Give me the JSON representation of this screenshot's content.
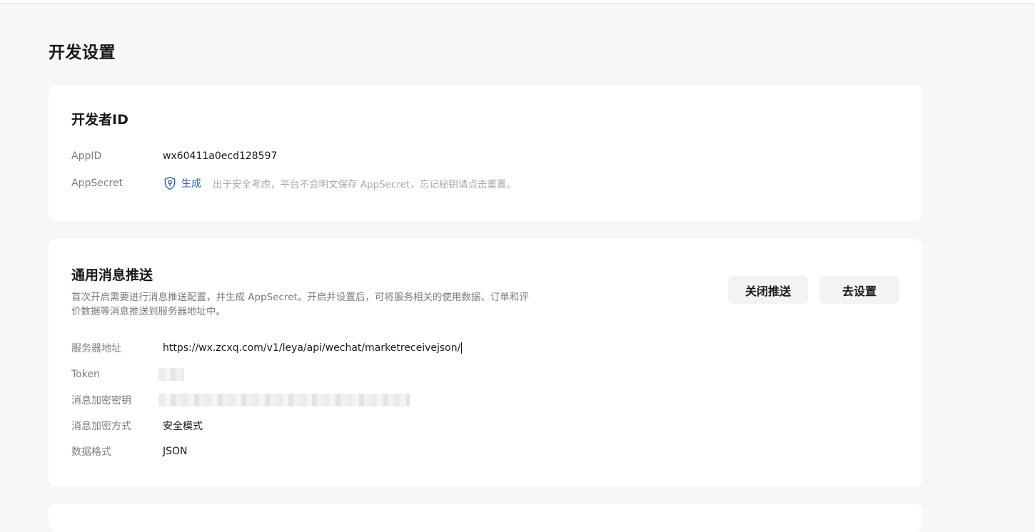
{
  "page": {
    "title": "开发设置"
  },
  "developer": {
    "title": "开发者ID",
    "appid_label": "AppID",
    "appid_value": "wx60411a0ecd128597",
    "secret_label": "AppSecret",
    "generate_label": "生成",
    "secret_hint": "出于安全考虑，平台不会明文保存 AppSecret，忘记秘钥请点击重置。"
  },
  "push": {
    "title": "通用消息推送",
    "description": "首次开启需要进行消息推送配置，并生成 AppSecret。开启并设置后，可将服务相关的使用数据、订单和评价数据等消息推送到服务器地址中。",
    "close_button": "关闭推送",
    "settings_button": "去设置",
    "fields": {
      "server_label": "服务器地址",
      "server_value": "https://wx.zcxq.com/v1/leya/api/wechat/marketreceivejson/",
      "token_label": "Token",
      "key_label": "消息加密密钥",
      "mode_label": "消息加密方式",
      "mode_value": "安全模式",
      "format_label": "数据格式",
      "format_value": "JSON"
    }
  },
  "colors": {
    "background": "#f7f7f7",
    "card": "#ffffff",
    "link": "#2b5fbf",
    "muted": "#7c7c7c",
    "button_bg": "#f3f3f3"
  },
  "icons": {
    "generate": "shield-key-icon"
  }
}
